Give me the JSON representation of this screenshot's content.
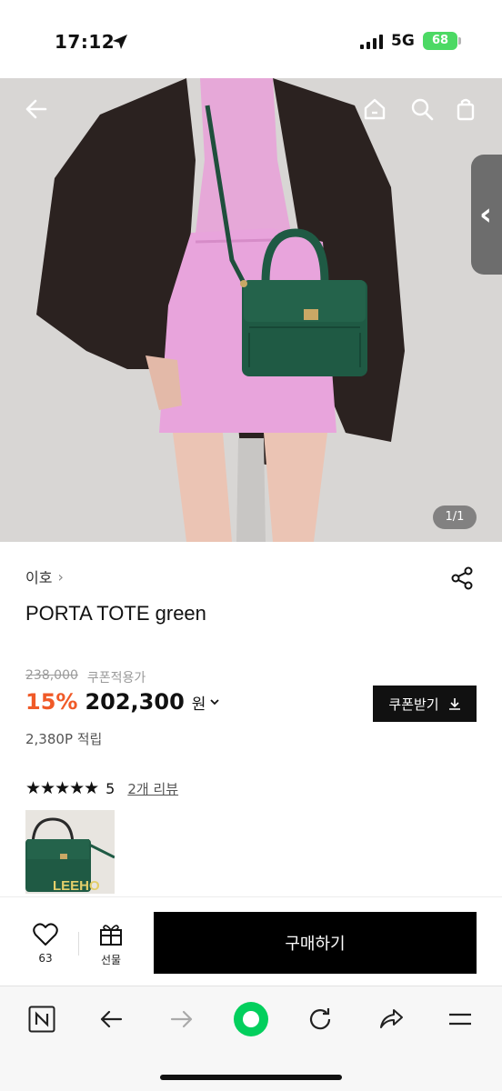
{
  "status_bar": {
    "time": "17:12",
    "network": "5G",
    "battery": "68"
  },
  "hero": {
    "page_indicator": "1/1"
  },
  "product": {
    "brand": "이호",
    "title": "PORTA TOTE green",
    "original_price": "238,000",
    "coupon_price_label": "쿠폰적용가",
    "discount": "15%",
    "price": "202,300",
    "currency": "원",
    "coupon_button": "쿠폰받기",
    "points": "2,380P 적립",
    "rating": "5",
    "review_count": "2개 리뷰",
    "review_thumb_text": "LEEHO"
  },
  "action_bar": {
    "like_count": "63",
    "gift_label": "선물",
    "buy_label": "구매하기"
  },
  "colors": {
    "accent": "#f05a28",
    "bag_green": "#1f5a44",
    "skirt_pink": "#e6a8d8",
    "jacket_brown": "#2b2220",
    "battery_green": "#4cd964"
  }
}
